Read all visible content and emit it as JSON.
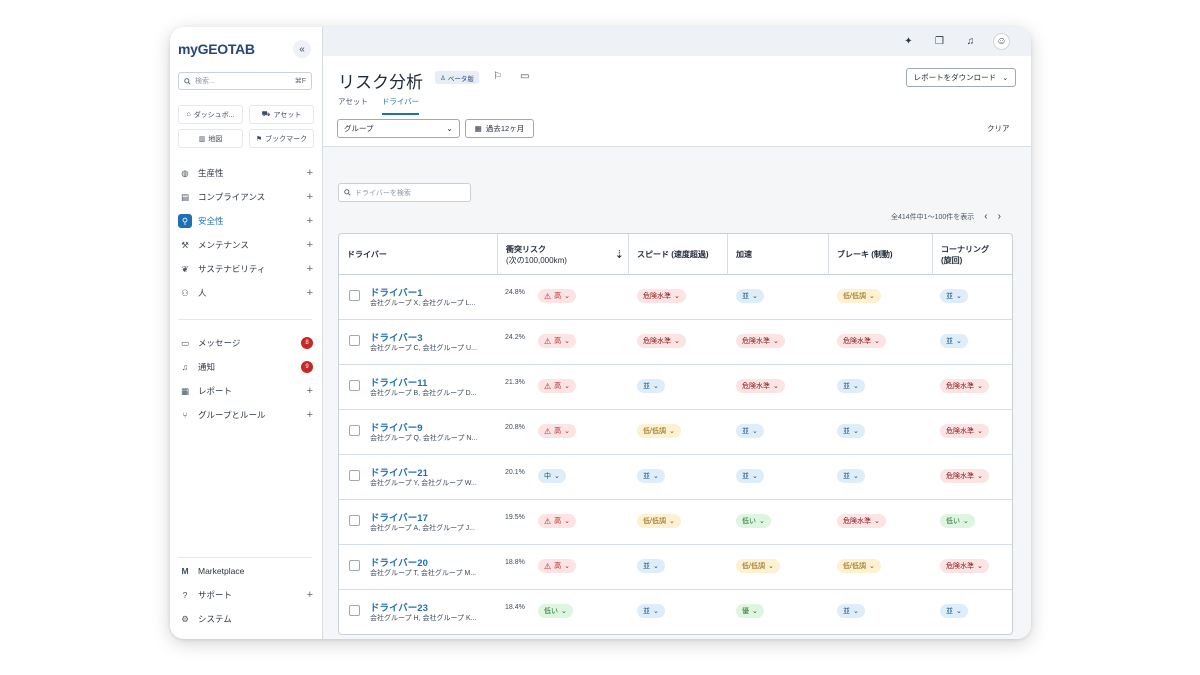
{
  "sidebar": {
    "logo_my": "my",
    "logo_brand": "GEOTAB",
    "search_placeholder": "検索...",
    "search_shortcut": "⌘F",
    "quick": [
      {
        "label": "ダッシュボ...",
        "icon": "home-icon"
      },
      {
        "label": "アセット",
        "icon": "truck-icon"
      },
      {
        "label": "地図",
        "icon": "map-icon"
      },
      {
        "label": "ブックマーク",
        "icon": "bookmark-icon"
      }
    ],
    "nav": [
      {
        "label": "生産性",
        "icon": "globe-icon"
      },
      {
        "label": "コンプライアンス",
        "icon": "clipboard-icon"
      },
      {
        "label": "安全性",
        "icon": "shield-icon"
      },
      {
        "label": "メンテナンス",
        "icon": "wrench-icon"
      },
      {
        "label": "サステナビリティ",
        "icon": "leaf-icon"
      },
      {
        "label": "人",
        "icon": "people-icon"
      }
    ],
    "nav2": [
      {
        "label": "メッセージ",
        "icon": "message-icon",
        "count": "8"
      },
      {
        "label": "通知",
        "icon": "bell-icon",
        "count": "9"
      },
      {
        "label": "レポート",
        "icon": "report-icon"
      },
      {
        "label": "グループとルール",
        "icon": "hierarchy-icon"
      }
    ],
    "bottom": [
      {
        "label": "Marketplace",
        "icon": "marketplace-icon"
      },
      {
        "label": "サポート",
        "icon": "help-icon"
      },
      {
        "label": "システム",
        "icon": "gear-icon"
      }
    ]
  },
  "header": {
    "title": "リスク分析",
    "beta": "ベータ版",
    "download": "レポートをダウンロード",
    "tabs": [
      "アセット",
      "ドライバー"
    ],
    "group": "グループ",
    "date_range": "過去12ヶ月",
    "clear": "クリア",
    "driver_search_placeholder": "ドライバーを検索",
    "pagination": "全414件中1〜100件を表示"
  },
  "table": {
    "columns": {
      "driver": "ドライバー",
      "risk": "衝突リスク",
      "risk_sub": "(次の100,000km)",
      "speed": "スピード (速度超過)",
      "accel": "加速",
      "brake": "ブレーキ (制動)",
      "corner": "コーナリング",
      "corner_sub": "(旋回)"
    },
    "rows": [
      {
        "name": "ドライバー1",
        "group": "会社グループ X, 会社グループ L...",
        "value": "24.8%",
        "risk": "高",
        "speed": "危険水準",
        "accel": "並",
        "brake": "低/低調",
        "corner": "並"
      },
      {
        "name": "ドライバー3",
        "group": "会社グループ C, 会社グループ U...",
        "value": "24.2%",
        "risk": "高",
        "speed": "危険水準",
        "accel": "危険水準",
        "brake": "危険水準",
        "corner": "並"
      },
      {
        "name": "ドライバー11",
        "group": "会社グループ B, 会社グループ D...",
        "value": "21.3%",
        "risk": "高",
        "speed": "並",
        "accel": "危険水準",
        "brake": "並",
        "corner": "危険水準"
      },
      {
        "name": "ドライバー9",
        "group": "会社グループ Q, 会社グループ N...",
        "value": "20.8%",
        "risk": "高",
        "speed": "低/低調",
        "accel": "並",
        "brake": "並",
        "corner": "危険水準"
      },
      {
        "name": "ドライバー21",
        "group": "会社グループ Y, 会社グループ W...",
        "value": "20.1%",
        "risk": "中",
        "speed": "並",
        "accel": "並",
        "brake": "並",
        "corner": "危険水準"
      },
      {
        "name": "ドライバー17",
        "group": "会社グループ A, 会社グループ J...",
        "value": "19.5%",
        "risk": "高",
        "speed": "低/低調",
        "accel": "低い",
        "brake": "危険水準",
        "corner": "低い"
      },
      {
        "name": "ドライバー20",
        "group": "会社グループ T, 会社グループ M...",
        "value": "18.8%",
        "risk": "高",
        "speed": "並",
        "accel": "低/低調",
        "brake": "低/低調",
        "corner": "危険水準"
      },
      {
        "name": "ドライバー23",
        "group": "会社グループ H, 会社グループ K...",
        "value": "18.4%",
        "risk": "低い",
        "speed": "並",
        "accel": "優",
        "brake": "並",
        "corner": "並"
      }
    ]
  }
}
